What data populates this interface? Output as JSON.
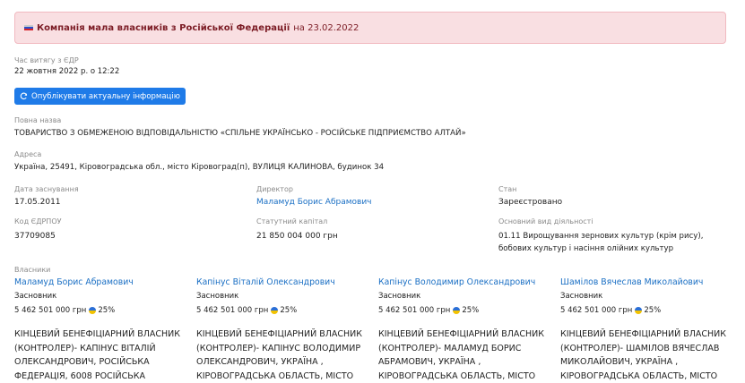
{
  "alert": {
    "flag_icon": "russia-flag-icon",
    "text": "Компанія мала власників з Російської Федерації",
    "date_text": "на 23.02.2022"
  },
  "extract": {
    "label": "Час витягу з ЄДР",
    "value": "22 жовтня 2022 р. о 12:22"
  },
  "publish_button": {
    "label": "Опублікувати актуальну інформацію",
    "icon": "refresh-icon"
  },
  "full_name": {
    "label": "Повна назва",
    "value": "ТОВАРИСТВО З ОБМЕЖЕНОЮ ВІДПОВІДАЛЬНІСТЮ «СПІЛЬНЕ УКРАЇНСЬКО - РОСІЙСЬКЕ ПІДПРИЄМСТВО АЛТАЙ»"
  },
  "address": {
    "label": "Адреса",
    "value": "Україна, 25491, Кіровоградська обл., місто Кіровоград(п), ВУЛИЦЯ КАЛИНОВА, будинок 34"
  },
  "founded": {
    "label": "Дата заснування",
    "value": "17.05.2011"
  },
  "director": {
    "label": "Директор",
    "value": "Маламуд Борис Абрамович"
  },
  "status": {
    "label": "Стан",
    "value": "Зареєстровано"
  },
  "edrpou": {
    "label": "Код ЄДРПОУ",
    "value": "37709085"
  },
  "capital": {
    "label": "Статутний капітал",
    "value": "21 850 004 000 грн"
  },
  "activity": {
    "label": "Основний вид діяльності",
    "line1": "01.11 Вирощування зернових культур (крім рису),",
    "line2": "бобових культур і насіння олійних культур"
  },
  "owners": {
    "label": "Власники",
    "items": [
      {
        "name": "Маламуд Борис Абрамович",
        "role": "Засновник",
        "amount": "5 462 501 000 грн",
        "percent": "25%",
        "desc": [
          "КІНЦЕВИЙ БЕНЕФІЦІАРНИЙ ВЛАСНИК",
          "(КОНТРОЛЕР)- КАПІНУС ВІТАЛІЙ",
          "ОЛЕКСАНДРОВИЧ, РОСІЙСЬКА",
          "ФЕДЕРАЦІЯ, 6008 РОСІЙСЬКА"
        ]
      },
      {
        "name": "Капінус Віталій Олександрович",
        "role": "Засновник",
        "amount": "5 462 501 000 грн",
        "percent": "25%",
        "desc": [
          "КІНЦЕВИЙ БЕНЕФІЦІАРНИЙ ВЛАСНИК",
          "(КОНТРОЛЕР)- КАПІНУС ВОЛОДИМИР",
          "ОЛЕКСАНДРОВИЧ, УКРАЇНА ,",
          "КІРОВОГРАДСЬКА ОБЛАСТЬ, МІСТО"
        ]
      },
      {
        "name": "Капінус Володимир Олександрович",
        "role": "Засновник",
        "amount": "5 462 501 000 грн",
        "percent": "25%",
        "desc": [
          "КІНЦЕВИЙ БЕНЕФІЦІАРНИЙ ВЛАСНИК",
          "(КОНТРОЛЕР)- МАЛАМУД БОРИС",
          "АБРАМОВИЧ, УКРАЇНА ,",
          "КІРОВОГРАДСЬКА ОБЛАСТЬ, МІСТО"
        ]
      },
      {
        "name": "Шамілов Вячеслав Миколайович",
        "role": "Засновник",
        "amount": "5 462 501 000 грн",
        "percent": "25%",
        "desc": [
          "КІНЦЕВИЙ БЕНЕФІЦІАРНИЙ ВЛАСНИК",
          "(КОНТРОЛЕР)- ШАМІЛОВ ВЯЧЕСЛАВ",
          "МИКОЛАЙОВИЧ, УКРАЇНА ,",
          "КІРОВОГРАДСЬКА ОБЛАСТЬ, МІСТО"
        ]
      }
    ]
  }
}
